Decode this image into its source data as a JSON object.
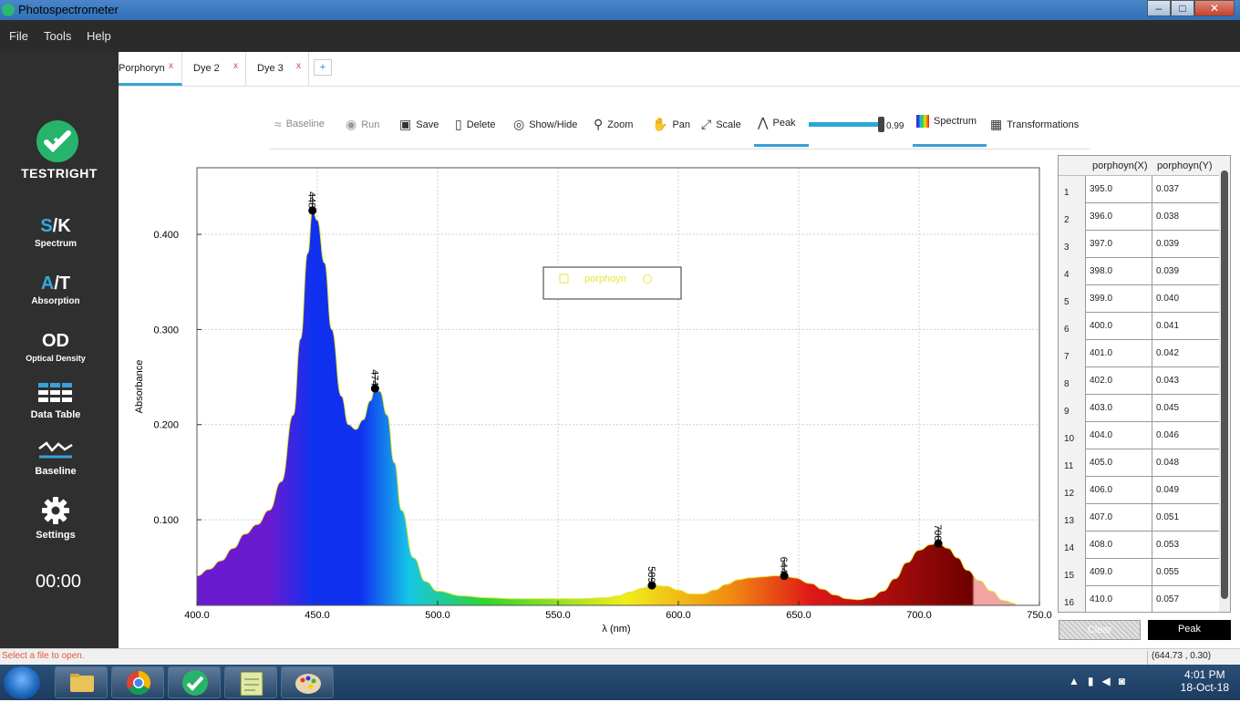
{
  "window": {
    "title": "Photospectrometer",
    "minimize": "–",
    "maximize": "□",
    "close": "✕"
  },
  "menu": {
    "file": "File",
    "tools": "Tools",
    "help": "Help"
  },
  "sidebar": {
    "logo_text": "TESTRIGHT",
    "items": [
      {
        "prefix": "S",
        "suffix": "/K",
        "label": "Spectrum"
      },
      {
        "prefix": "A",
        "suffix": "/T",
        "label": "Absorption"
      },
      {
        "prefix": "",
        "suffix": "OD",
        "label": "Optical Density"
      },
      {
        "label": "Data Table",
        "icon": "table-icon"
      },
      {
        "label": "Baseline",
        "icon": "baseline-wave-icon"
      },
      {
        "label": "Settings",
        "icon": "gear-icon"
      }
    ],
    "timer": "00:00"
  },
  "tabs": [
    {
      "label": "Porphoryn",
      "close": "x",
      "active": true
    },
    {
      "label": "Dye 2",
      "close": "x",
      "active": false
    },
    {
      "label": "Dye 3",
      "close": "x",
      "active": false
    }
  ],
  "tab_add": "+",
  "toolbar": {
    "baseline": "Baseline",
    "run": "Run",
    "save": "Save",
    "delete": "Delete",
    "show_hide": "Show/Hide",
    "zoom": "Zoom",
    "pan": "Pan",
    "scale": "Scale",
    "peak": "Peak",
    "slider_value": "0.99",
    "spectrum": "Spectrum",
    "transformations": "Transformations"
  },
  "chart_data": {
    "type": "area",
    "xlabel": "λ (nm)",
    "ylabel": "Absorbance",
    "xlim": [
      400,
      750
    ],
    "ylim": [
      0.01,
      0.47
    ],
    "xticks": [
      "400.0",
      "450.0",
      "500.0",
      "550.0",
      "600.0",
      "650.0",
      "700.0",
      "750.0"
    ],
    "yticks": [
      "0.100",
      "0.200",
      "0.300",
      "0.400"
    ],
    "grid": true,
    "legend": {
      "placement": "top-center",
      "entries": [
        "porphoyn"
      ]
    },
    "series": [
      {
        "name": "porphoyn",
        "x": [
          395,
          400,
          405,
          410,
          415,
          420,
          425,
          430,
          435,
          440,
          443,
          446,
          448,
          450,
          453,
          456,
          460,
          463,
          466,
          469,
          472,
          474,
          476,
          479,
          482,
          485,
          490,
          495,
          500,
          510,
          520,
          530,
          540,
          550,
          560,
          570,
          575,
          580,
          585,
          589,
          595,
          600,
          605,
          610,
          615,
          620,
          625,
          630,
          635,
          640,
          644,
          648,
          655,
          660,
          665,
          670,
          675,
          680,
          685,
          690,
          695,
          700,
          705,
          708,
          712,
          716,
          720,
          725,
          730,
          735,
          740
        ],
        "y": [
          0.037,
          0.041,
          0.048,
          0.057,
          0.07,
          0.085,
          0.095,
          0.11,
          0.14,
          0.21,
          0.29,
          0.38,
          0.425,
          0.415,
          0.37,
          0.3,
          0.23,
          0.2,
          0.195,
          0.205,
          0.225,
          0.238,
          0.235,
          0.21,
          0.16,
          0.11,
          0.06,
          0.035,
          0.025,
          0.02,
          0.018,
          0.017,
          0.017,
          0.017,
          0.017,
          0.018,
          0.02,
          0.024,
          0.028,
          0.031,
          0.03,
          0.026,
          0.022,
          0.022,
          0.026,
          0.032,
          0.037,
          0.039,
          0.04,
          0.041,
          0.041,
          0.039,
          0.033,
          0.027,
          0.021,
          0.017,
          0.016,
          0.018,
          0.025,
          0.038,
          0.055,
          0.068,
          0.074,
          0.075,
          0.07,
          0.06,
          0.047,
          0.036,
          0.025,
          0.015,
          0.012
        ]
      }
    ],
    "peaks": [
      {
        "x": 448,
        "y": 0.425,
        "label": "448"
      },
      {
        "x": 474,
        "y": 0.238,
        "label": "474"
      },
      {
        "x": 589,
        "y": 0.031,
        "label": "589"
      },
      {
        "x": 644,
        "y": 0.041,
        "label": "644"
      },
      {
        "x": 708,
        "y": 0.075,
        "label": "708"
      }
    ],
    "colors": {
      "violet": "#6a1bd0",
      "blue": "#1030f0",
      "cyan": "#16c6e8",
      "green": "#2fd42f",
      "yellow": "#f0ee1a",
      "orange": "#f08a12",
      "red": "#e01818",
      "darkred": "#6e0000",
      "pink": "#f3a3a3",
      "outline": "#e6e63c"
    }
  },
  "table": {
    "headers": [
      "porphoyn(X)",
      "porphoyn(Y)"
    ],
    "rows": [
      [
        "1",
        "395.0",
        "0.037"
      ],
      [
        "2",
        "396.0",
        "0.038"
      ],
      [
        "3",
        "397.0",
        "0.039"
      ],
      [
        "4",
        "398.0",
        "0.039"
      ],
      [
        "5",
        "399.0",
        "0.040"
      ],
      [
        "6",
        "400.0",
        "0.041"
      ],
      [
        "7",
        "401.0",
        "0.042"
      ],
      [
        "8",
        "402.0",
        "0.043"
      ],
      [
        "9",
        "403.0",
        "0.045"
      ],
      [
        "10",
        "404.0",
        "0.046"
      ],
      [
        "11",
        "405.0",
        "0.048"
      ],
      [
        "12",
        "406.0",
        "0.049"
      ],
      [
        "13",
        "407.0",
        "0.051"
      ],
      [
        "14",
        "408.0",
        "0.053"
      ],
      [
        "15",
        "409.0",
        "0.055"
      ],
      [
        "16",
        "410.0",
        "0.057"
      ]
    ]
  },
  "buttons": {
    "clear": "Clear",
    "peak": "Peak"
  },
  "status": {
    "message": "Select a file to open.",
    "coords": "(644.73 , 0.30)"
  },
  "taskbar": {
    "time": "4:01 PM",
    "date": "18-Oct-18"
  }
}
